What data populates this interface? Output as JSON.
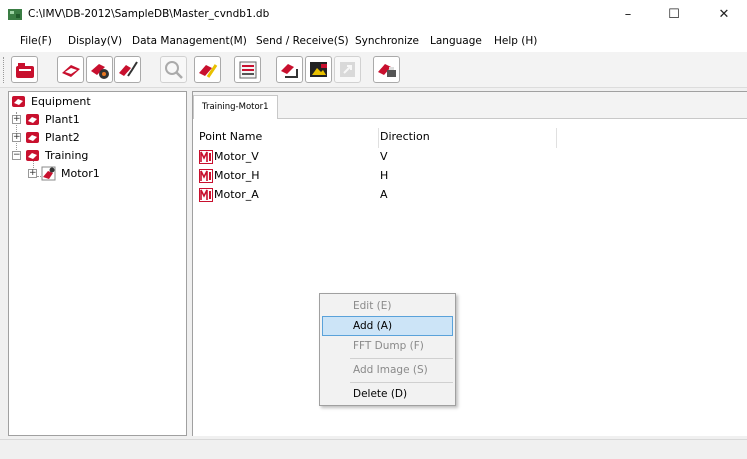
{
  "window": {
    "title": "C:\\IMV\\DB-2012\\SampleDB\\Master_cvndb1.db",
    "minimize_glyph": "–",
    "maximize_glyph": "☐",
    "close_glyph": "✕"
  },
  "menu": {
    "items": [
      "File(F)",
      "Display(V)",
      "Data Management(M)",
      "Send / Receive(S)",
      "Synchronize",
      "Language",
      "Help (H)"
    ]
  },
  "toolbar": {
    "buttons": [
      {
        "icon": "open-db-icon",
        "enabled": true
      },
      {
        "icon": "equipment-icon",
        "enabled": true
      },
      {
        "icon": "settings-icon",
        "enabled": true
      },
      {
        "icon": "measure-icon",
        "enabled": true
      },
      {
        "icon": "search-icon",
        "enabled": false
      },
      {
        "icon": "edit-icon",
        "enabled": true
      },
      {
        "icon": "list-icon",
        "enabled": true
      },
      {
        "icon": "route-icon",
        "enabled": true
      },
      {
        "icon": "image-icon",
        "enabled": true
      },
      {
        "icon": "export-icon",
        "enabled": false
      },
      {
        "icon": "print-icon",
        "enabled": true
      }
    ]
  },
  "tree": {
    "root": "Equipment",
    "plant1": "Plant1",
    "plant2": "Plant2",
    "training": "Training",
    "motor1": "Motor1",
    "collapsed_glyph": "+",
    "expanded_glyph": "−"
  },
  "tab": {
    "label": "Training-Motor1"
  },
  "table": {
    "columns": [
      "Point Name",
      "Direction"
    ],
    "rows": [
      {
        "name": "Motor_V",
        "direction": "V"
      },
      {
        "name": "Motor_H",
        "direction": "H"
      },
      {
        "name": "Motor_A",
        "direction": "A"
      }
    ]
  },
  "context_menu": {
    "items": [
      {
        "label": "Edit (E)",
        "enabled": false
      },
      {
        "label": "Add (A)",
        "enabled": true,
        "highlighted": true
      },
      {
        "label": "FFT Dump (F)",
        "enabled": false
      },
      {
        "label": "Add Image (S)",
        "enabled": false
      },
      {
        "label": "Delete (D)",
        "enabled": true
      }
    ]
  },
  "colors": {
    "accent_red": "#c8102e",
    "highlight": "#cce4f7"
  }
}
